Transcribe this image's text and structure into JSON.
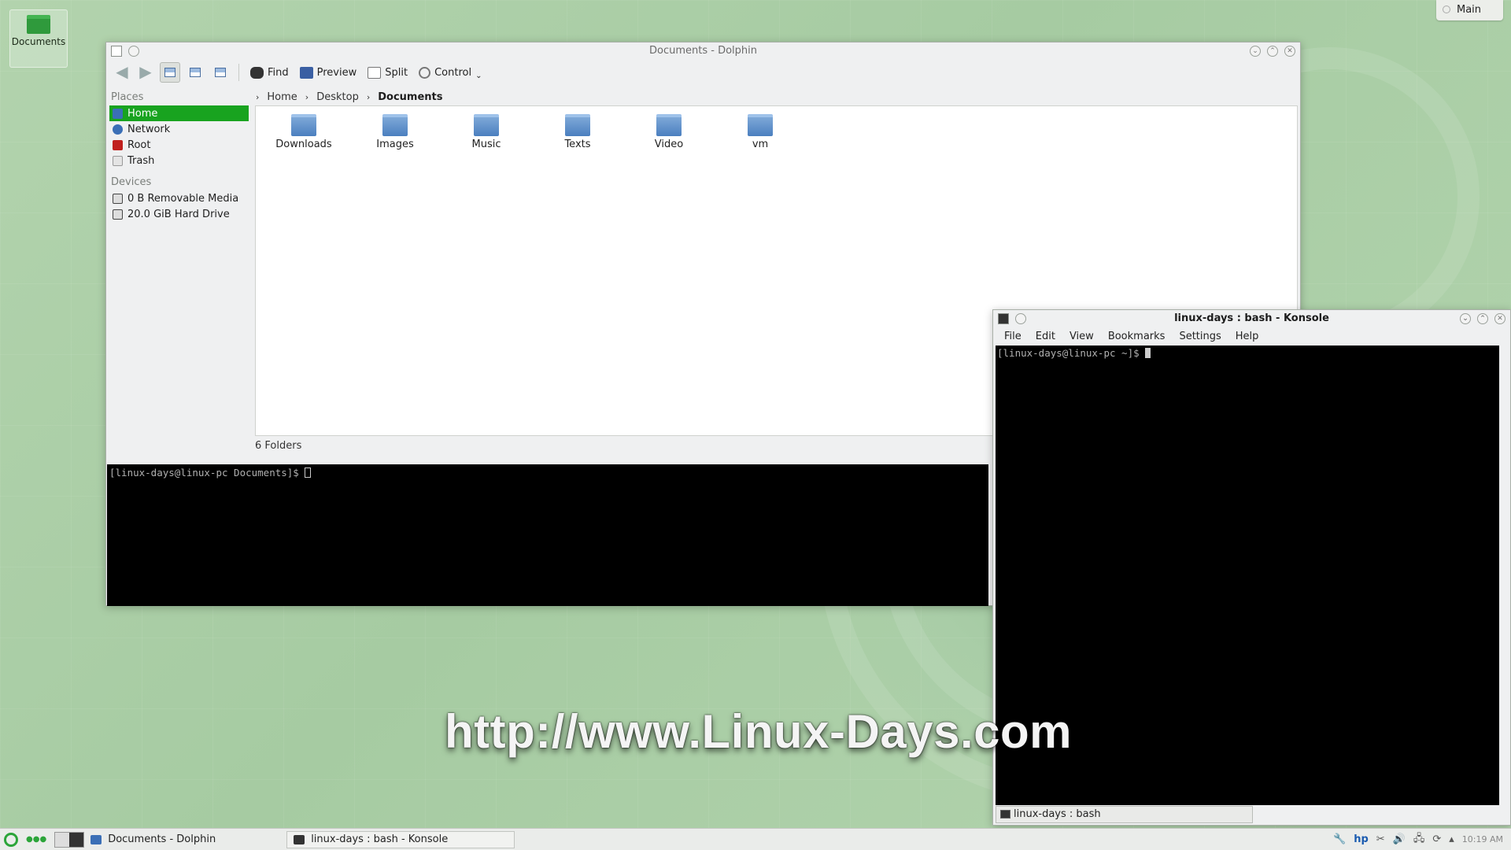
{
  "desktop": {
    "icon_label": "Documents",
    "main_button": "Main",
    "watermark": "http://www.Linux-Days.com"
  },
  "dolphin": {
    "title": "Documents - Dolphin",
    "toolbar": {
      "find": "Find",
      "preview": "Preview",
      "split": "Split",
      "control": "Control"
    },
    "places_header": "Places",
    "places": [
      {
        "label": "Home",
        "icon": "home-icon",
        "color": "#3b6fb6"
      },
      {
        "label": "Network",
        "icon": "network-icon",
        "color": "#3b6fb6"
      },
      {
        "label": "Root",
        "icon": "root-folder-icon",
        "color": "#c0201e"
      },
      {
        "label": "Trash",
        "icon": "trash-icon",
        "color": "#d8d8d8"
      }
    ],
    "devices_header": "Devices",
    "devices": [
      {
        "label": "0 B Removable Media",
        "icon": "removable-media-icon"
      },
      {
        "label": "20.0 GiB Hard Drive",
        "icon": "hard-drive-icon"
      }
    ],
    "breadcrumb": [
      "Home",
      "Desktop",
      "Documents"
    ],
    "folders": [
      "Downloads",
      "Images",
      "Music",
      "Texts",
      "Video",
      "vm"
    ],
    "status": "6 Folders",
    "terminal_prompt": "[linux-days@linux-pc Documents]$ "
  },
  "konsole": {
    "title": "linux-days : bash - Konsole",
    "menu": [
      "File",
      "Edit",
      "View",
      "Bookmarks",
      "Settings",
      "Help"
    ],
    "prompt": "[linux-days@linux-pc ~]$ ",
    "tab_label": "linux-days : bash"
  },
  "taskbar": {
    "tasks": [
      "Documents - Dolphin",
      "linux-days : bash - Konsole"
    ],
    "clock": "10:19 AM"
  },
  "colors": {
    "accent": "#18a31f",
    "folder": "#4b7fbf"
  }
}
